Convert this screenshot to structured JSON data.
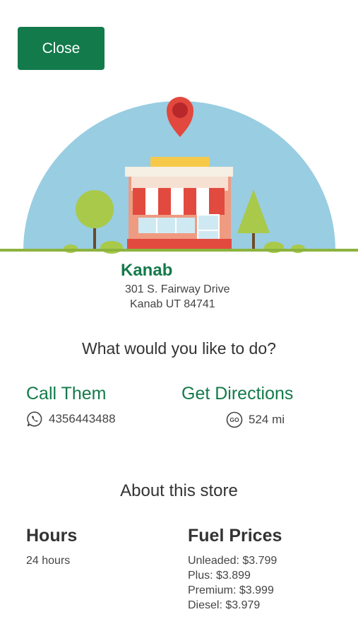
{
  "header": {
    "close_label": "Close"
  },
  "store": {
    "name": "Kanab",
    "address_line1": "301 S. Fairway Drive",
    "address_line2": "Kanab  UT  84741"
  },
  "actions": {
    "prompt": "What would you like to do?",
    "call_label": "Call Them",
    "phone": "4356443488",
    "directions_label": "Get Directions",
    "distance": "524 mi"
  },
  "about": {
    "title": "About this store",
    "hours_heading": "Hours",
    "hours_value": "24 hours",
    "fuel_heading": "Fuel Prices",
    "fuel_prices": [
      "Unleaded: $3.799",
      "Plus: $3.899",
      "Premium: $3.999",
      "Diesel: $3.979"
    ]
  },
  "icons": {
    "phone": "whatsapp-phone-icon",
    "distance": "go-icon",
    "pin": "map-pin-icon"
  },
  "colors": {
    "brand": "#137a4b",
    "sky": "#99cde2",
    "pin": "#e2483d",
    "awning": "#e24a3f",
    "grass": "#8db33e"
  }
}
